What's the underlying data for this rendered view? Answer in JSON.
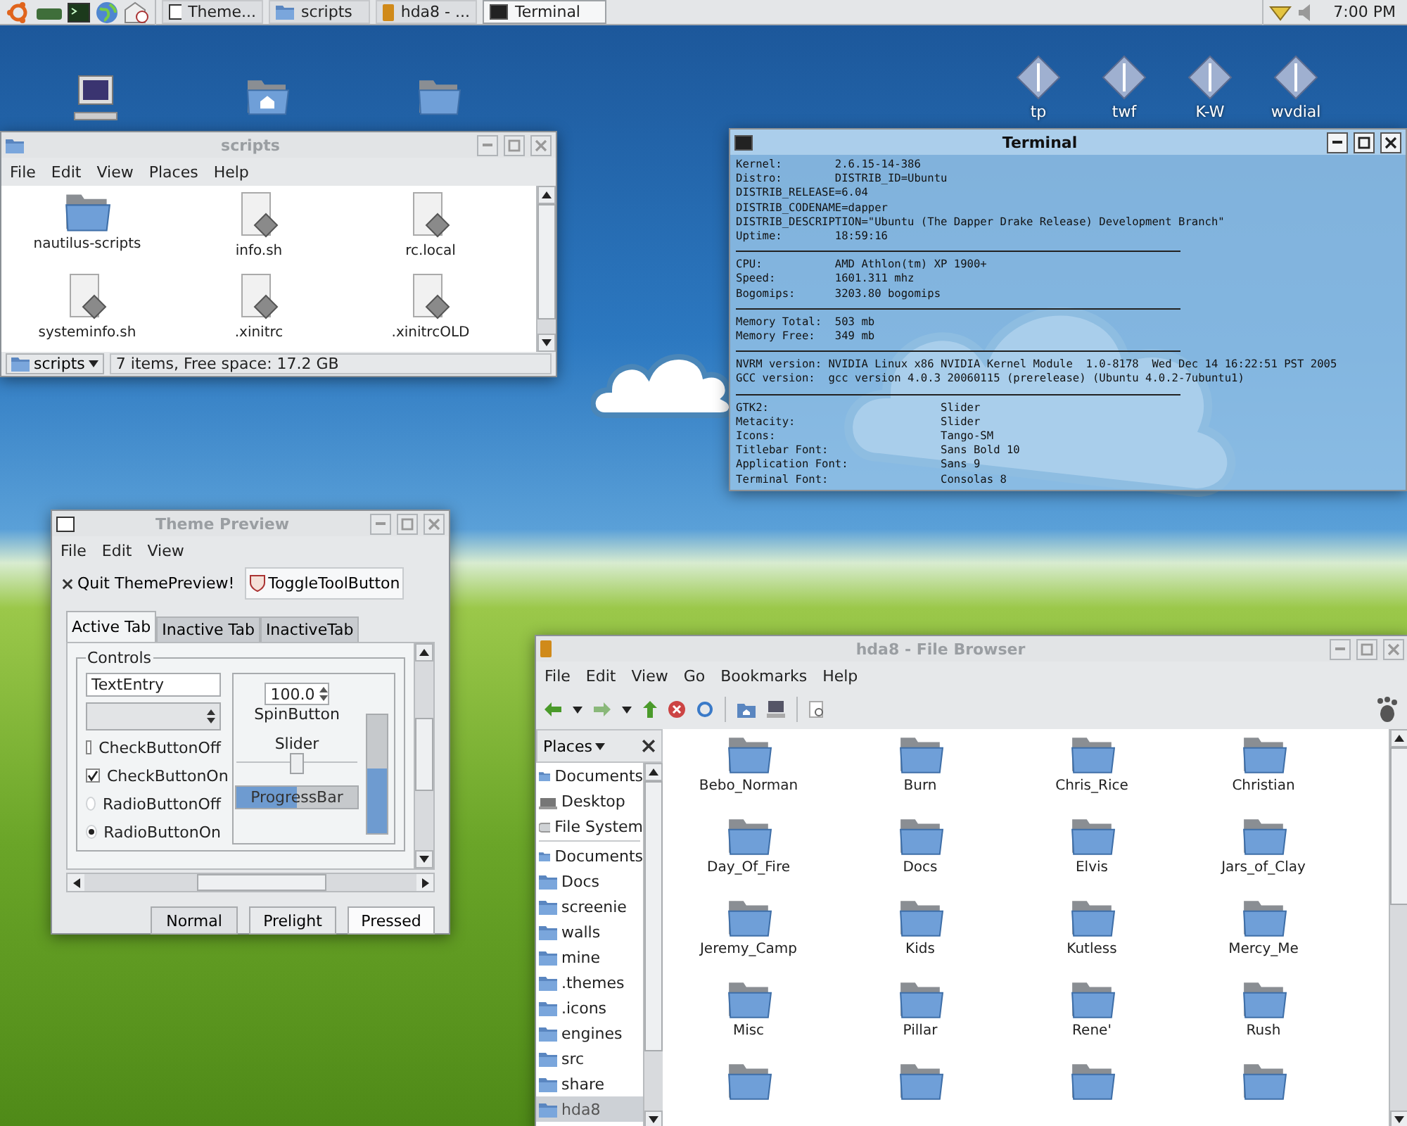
{
  "panel": {
    "tasks": [
      {
        "label": "Theme...",
        "kind": "window",
        "selected": false
      },
      {
        "label": "scripts",
        "kind": "folder",
        "selected": false
      },
      {
        "label": "hda8 - ...",
        "kind": "drive",
        "selected": false
      },
      {
        "label": "Terminal",
        "kind": "terminal",
        "selected": true
      }
    ],
    "clock": "7:00 PM"
  },
  "desktop_icons": [
    {
      "label": "tp"
    },
    {
      "label": "twf"
    },
    {
      "label": "K-W"
    },
    {
      "label": "wvdial"
    }
  ],
  "scripts_window": {
    "title": "scripts",
    "menu": [
      "File",
      "Edit",
      "View",
      "Places",
      "Help"
    ],
    "files": [
      {
        "name": "nautilus-scripts",
        "kind": "folder"
      },
      {
        "name": "info.sh",
        "kind": "script"
      },
      {
        "name": "rc.local",
        "kind": "script"
      },
      {
        "name": "systeminfo.sh",
        "kind": "script"
      },
      {
        "name": ".xinitrc",
        "kind": "script"
      },
      {
        "name": ".xinitrcOLD",
        "kind": "script"
      }
    ],
    "location": "scripts",
    "status": "7 items, Free space: 17.2 GB"
  },
  "terminal": {
    "title": "Terminal",
    "groups": [
      [
        "Kernel:        2.6.15-14-386",
        "Distro:        DISTRIB_ID=Ubuntu",
        "DISTRIB_RELEASE=6.04",
        "DISTRIB_CODENAME=dapper",
        "DISTRIB_DESCRIPTION=\"Ubuntu (The Dapper Drake Release) Development Branch\"",
        "Uptime:        18:59:16"
      ],
      [
        "CPU:           AMD Athlon(tm) XP 1900+",
        "Speed:         1601.311 mhz",
        "Bogomips:      3203.80 bogomips"
      ],
      [
        "Memory Total:  503 mb",
        "Memory Free:   349 mb"
      ],
      [
        "NVRM version: NVIDIA Linux x86 NVIDIA Kernel Module  1.0-8178  Wed Dec 14 16:22:51 PST 2005",
        "GCC version:  gcc version 4.0.3 20060115 (prerelease) (Ubuntu 4.0.2-7ubuntu1)"
      ],
      [
        "GTK2:                          Slider",
        "Metacity:                      Slider",
        "Icons:                         Tango-SM",
        "Titlebar Font:                 Sans Bold 10",
        "Application Font:              Sans 9",
        "Terminal Font:                 Consolas 8"
      ]
    ]
  },
  "theme_preview": {
    "title": "Theme Preview",
    "menu": [
      "File",
      "Edit",
      "View"
    ],
    "quit": "Quit ThemePreview!",
    "toggle": {
      "label": "ToggleToolButton",
      "on": true
    },
    "tabs": [
      {
        "label": "Active Tab",
        "selected": true
      },
      {
        "label": "Inactive Tab",
        "selected": false
      },
      {
        "label": "InactiveTab",
        "selected": false
      }
    ],
    "frame": "Controls",
    "entry": "TextEntry",
    "options": [
      {
        "kind": "check",
        "label": "CheckButtonOff",
        "checked": false
      },
      {
        "kind": "check",
        "label": "CheckButtonOn",
        "checked": true
      },
      {
        "kind": "radio",
        "label": "RadioButtonOff",
        "checked": false
      },
      {
        "kind": "radio",
        "label": "RadioButtonOn",
        "checked": true
      }
    ],
    "spin": "100.0",
    "spin_label": "SpinButton",
    "slider_label": "Slider",
    "slider": {
      "level": 0.5
    },
    "progress": {
      "label": "ProgressBar",
      "level": 0.5
    },
    "vbar": {
      "level": 0.55
    },
    "buttons": [
      {
        "label": "Normal",
        "kind": "normal"
      },
      {
        "label": "Prelight",
        "kind": "prelight"
      },
      {
        "label": "Pressed",
        "kind": "pressed"
      }
    ]
  },
  "file_browser": {
    "title": "hda8 - File Browser",
    "menu": [
      "File",
      "Edit",
      "View",
      "Go",
      "Bookmarks",
      "Help"
    ],
    "places_title": "Places",
    "places": [
      {
        "name": "Documents",
        "kind": "folder",
        "selected": false
      },
      {
        "name": "Desktop",
        "kind": "desktop",
        "selected": false
      },
      {
        "name": "File System",
        "kind": "drive",
        "selected": false
      },
      {
        "name": "Documents",
        "kind": "bookmark",
        "selected": false
      },
      {
        "name": "Docs",
        "kind": "bookmark",
        "selected": false
      },
      {
        "name": "screenie",
        "kind": "bookmark",
        "selected": false
      },
      {
        "name": "walls",
        "kind": "bookmark",
        "selected": false
      },
      {
        "name": "mine",
        "kind": "bookmark",
        "selected": false
      },
      {
        "name": ".themes",
        "kind": "bookmark",
        "selected": false
      },
      {
        "name": ".icons",
        "kind": "bookmark",
        "selected": false
      },
      {
        "name": "engines",
        "kind": "bookmark",
        "selected": false
      },
      {
        "name": "src",
        "kind": "bookmark",
        "selected": false
      },
      {
        "name": "share",
        "kind": "bookmark",
        "selected": false
      },
      {
        "name": "hda8",
        "kind": "bookmark",
        "selected": true
      }
    ],
    "folders": [
      {
        "name": "Bebo_Norman",
        "kind": "folder"
      },
      {
        "name": "Burn",
        "kind": "folder"
      },
      {
        "name": "Chris_Rice",
        "kind": "folder"
      },
      {
        "name": "Christian",
        "kind": "folder"
      },
      {
        "name": "Day_Of_Fire",
        "kind": "folder"
      },
      {
        "name": "Docs",
        "kind": "folder"
      },
      {
        "name": "Elvis",
        "kind": "folder"
      },
      {
        "name": "Jars_of_Clay",
        "kind": "folder"
      },
      {
        "name": "Jeremy_Camp",
        "kind": "folder"
      },
      {
        "name": "Kids",
        "kind": "folder"
      },
      {
        "name": "Kutless",
        "kind": "folder"
      },
      {
        "name": "Mercy_Me",
        "kind": "folder"
      },
      {
        "name": "Misc",
        "kind": "folder"
      },
      {
        "name": "Pillar",
        "kind": "folder"
      },
      {
        "name": "Rene'",
        "kind": "folder"
      },
      {
        "name": "Rush",
        "kind": "folder"
      },
      {
        "kind": "folder"
      },
      {
        "kind": "folder"
      },
      {
        "kind": "folder"
      },
      {
        "kind": "folder"
      }
    ]
  }
}
